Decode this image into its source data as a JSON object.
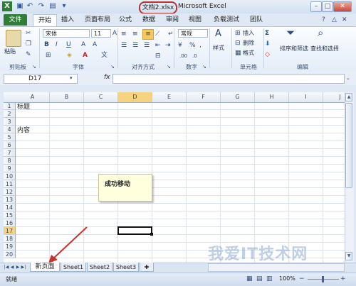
{
  "titlebar": {
    "file_name": "文档2.xlsx",
    "app_name": "Microsoft Excel"
  },
  "ribbon_tabs": [
    "文件",
    "开始",
    "插入",
    "页面布局",
    "公式",
    "数据",
    "审阅",
    "视图",
    "负载测试",
    "团队"
  ],
  "ribbon": {
    "paste": "粘贴",
    "font_name": "宋体",
    "font_size": "11",
    "number_format": "常规",
    "percent": "%",
    "comma": ",",
    "styles": "样式",
    "insert": "插入",
    "delete": "删除",
    "format": "格式",
    "sort_filter": "排序和筛选",
    "find_select": "查找和选择",
    "groups": {
      "clipboard": "剪贴板",
      "font": "字体",
      "alignment": "对齐方式",
      "number": "数字",
      "cells": "单元格",
      "editing": "编辑"
    }
  },
  "formula_bar": {
    "name_box": "D17",
    "fx": "fx",
    "value": ""
  },
  "grid": {
    "columns": [
      "A",
      "B",
      "C",
      "D",
      "E",
      "F",
      "G",
      "H",
      "I",
      "J"
    ],
    "rows": [
      "1",
      "2",
      "3",
      "4",
      "5",
      "6",
      "7",
      "8",
      "9",
      "10",
      "11",
      "12",
      "13",
      "14",
      "15",
      "16",
      "17",
      "18",
      "19",
      "20"
    ],
    "selected_cell": "D17",
    "cells": {
      "A1": "标题",
      "A4": "内容"
    }
  },
  "popup_text": "成功移动",
  "sheet_tabs": [
    "新页面",
    "Sheet1",
    "Sheet2",
    "Sheet3"
  ],
  "status": {
    "ready": "就绪",
    "zoom": "100%"
  },
  "watermark": "我爱IT技术网",
  "colors": {
    "file_tab": "#2f7d37",
    "highlight": "#b8332e",
    "arrow": "#c8332d"
  }
}
